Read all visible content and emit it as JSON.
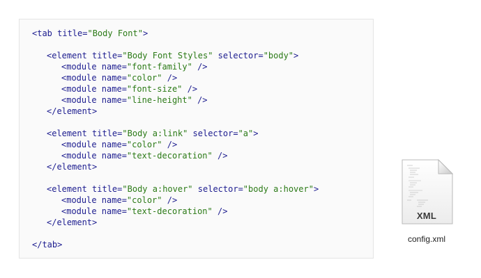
{
  "code": {
    "lines": [
      {
        "indent": 0,
        "parts": [
          [
            "p",
            "<tab "
          ],
          [
            "p",
            "title="
          ],
          [
            "s",
            "\"Body Font\""
          ],
          [
            "p",
            ">"
          ]
        ]
      },
      {
        "indent": 0,
        "parts": []
      },
      {
        "indent": 1,
        "parts": [
          [
            "p",
            "<element "
          ],
          [
            "p",
            "title="
          ],
          [
            "s",
            "\"Body Font Styles\""
          ],
          [
            "p",
            " selector="
          ],
          [
            "s",
            "\"body\""
          ],
          [
            "p",
            ">"
          ]
        ]
      },
      {
        "indent": 2,
        "parts": [
          [
            "p",
            "<module "
          ],
          [
            "p",
            "name="
          ],
          [
            "s",
            "\"font-family\""
          ],
          [
            "p",
            " />"
          ]
        ]
      },
      {
        "indent": 2,
        "parts": [
          [
            "p",
            "<module "
          ],
          [
            "p",
            "name="
          ],
          [
            "s",
            "\"color\""
          ],
          [
            "p",
            " />"
          ]
        ]
      },
      {
        "indent": 2,
        "parts": [
          [
            "p",
            "<module "
          ],
          [
            "p",
            "name="
          ],
          [
            "s",
            "\"font-size\""
          ],
          [
            "p",
            " />"
          ]
        ]
      },
      {
        "indent": 2,
        "parts": [
          [
            "p",
            "<module "
          ],
          [
            "p",
            "name="
          ],
          [
            "s",
            "\"line-height\""
          ],
          [
            "p",
            " />"
          ]
        ]
      },
      {
        "indent": 1,
        "parts": [
          [
            "p",
            "</element>"
          ]
        ]
      },
      {
        "indent": 0,
        "parts": []
      },
      {
        "indent": 1,
        "parts": [
          [
            "p",
            "<element "
          ],
          [
            "p",
            "title="
          ],
          [
            "s",
            "\"Body a:link\""
          ],
          [
            "p",
            " selector="
          ],
          [
            "s",
            "\"a\""
          ],
          [
            "p",
            ">"
          ]
        ]
      },
      {
        "indent": 2,
        "parts": [
          [
            "p",
            "<module "
          ],
          [
            "p",
            "name="
          ],
          [
            "s",
            "\"color\""
          ],
          [
            "p",
            " />"
          ]
        ]
      },
      {
        "indent": 2,
        "parts": [
          [
            "p",
            "<module "
          ],
          [
            "p",
            "name="
          ],
          [
            "s",
            "\"text-decoration\""
          ],
          [
            "p",
            " />"
          ]
        ]
      },
      {
        "indent": 1,
        "parts": [
          [
            "p",
            "</element>"
          ]
        ]
      },
      {
        "indent": 0,
        "parts": []
      },
      {
        "indent": 1,
        "parts": [
          [
            "p",
            "<element "
          ],
          [
            "p",
            "title="
          ],
          [
            "s",
            "\"Body a:hover\""
          ],
          [
            "p",
            " selector="
          ],
          [
            "s",
            "\"body a:hover\""
          ],
          [
            "p",
            ">"
          ]
        ]
      },
      {
        "indent": 2,
        "parts": [
          [
            "p",
            "<module "
          ],
          [
            "p",
            "name="
          ],
          [
            "s",
            "\"color\""
          ],
          [
            "p",
            " />"
          ]
        ]
      },
      {
        "indent": 2,
        "parts": [
          [
            "p",
            "<module "
          ],
          [
            "p",
            "name="
          ],
          [
            "s",
            "\"text-decoration\""
          ],
          [
            "p",
            " />"
          ]
        ]
      },
      {
        "indent": 1,
        "parts": [
          [
            "p",
            "</element>"
          ]
        ]
      },
      {
        "indent": 0,
        "parts": []
      },
      {
        "indent": 0,
        "parts": [
          [
            "p",
            "</tab>"
          ]
        ]
      }
    ]
  },
  "file": {
    "icon": "xml-document-icon",
    "extension_label": "XML",
    "name": "config.xml"
  },
  "colors": {
    "punctuation": "#1c1c8f",
    "string": "#2b7a16",
    "panel_background": "#fafafa",
    "panel_border": "#e4e4e4"
  }
}
